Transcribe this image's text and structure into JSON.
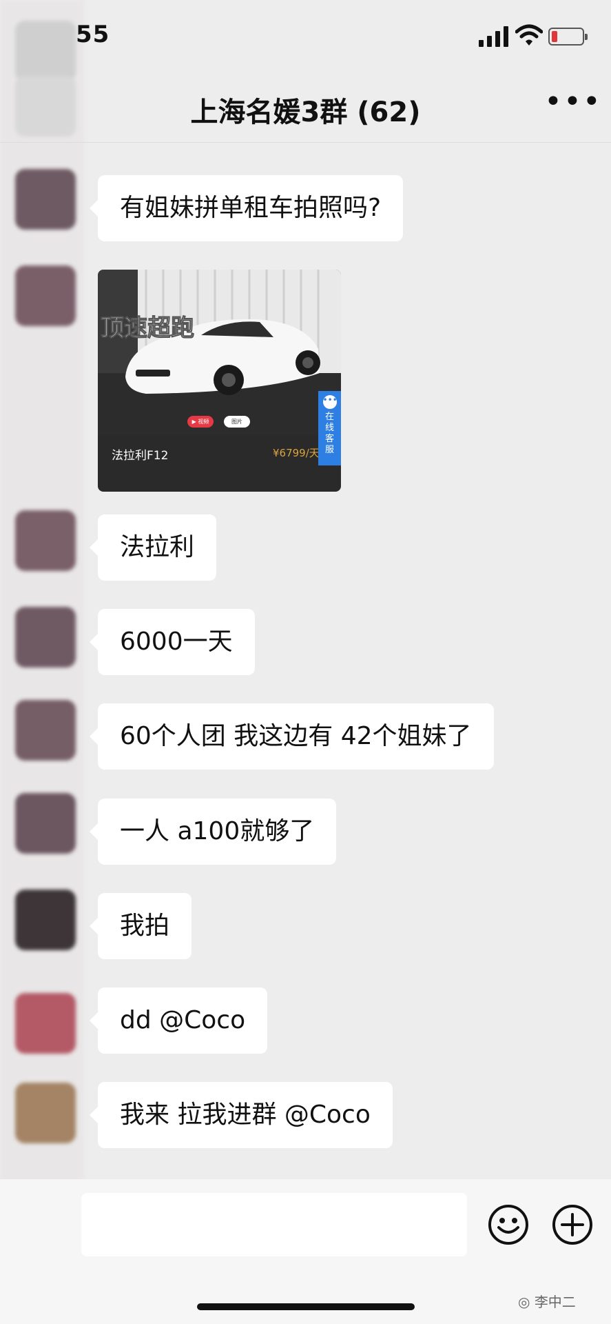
{
  "status_bar": {
    "time": "55",
    "signal_icon": "signal-bars-icon",
    "wifi_icon": "wifi-icon",
    "battery": {
      "icon": "battery-low-icon",
      "color": "#e3343a"
    }
  },
  "header": {
    "title": "上海名媛3群 (62)",
    "more_icon": "ellipsis-icon"
  },
  "messages": [
    {
      "text": "有姐妹拼单租车拍照吗?"
    },
    {
      "type": "link-card",
      "overlay_text": "顶速超跑",
      "name": "法拉利F12",
      "price": "¥6799/天",
      "video_label": "▶ 视频",
      "photo_label": "图片",
      "service_label": "在线客服"
    },
    {
      "text": "法拉利"
    },
    {
      "text": "6000一天"
    },
    {
      "text": "60个人团 我这边有 42个姐妹了"
    },
    {
      "text": "一人 a100就够了"
    },
    {
      "text": "我拍"
    },
    {
      "text": "dd @Coco"
    },
    {
      "text": "我来 拉我进群 @Coco"
    }
  ],
  "input_bar": {
    "emoji_icon": "emoji-face-icon",
    "plus_icon": "plus-circle-icon"
  },
  "watermark": {
    "icon": "wechat-icon",
    "text": "李中二"
  },
  "colors": {
    "background": "#ededed",
    "bubble": "#ffffff",
    "service_tab": "#2d7fe3",
    "price": "#d9a441"
  }
}
